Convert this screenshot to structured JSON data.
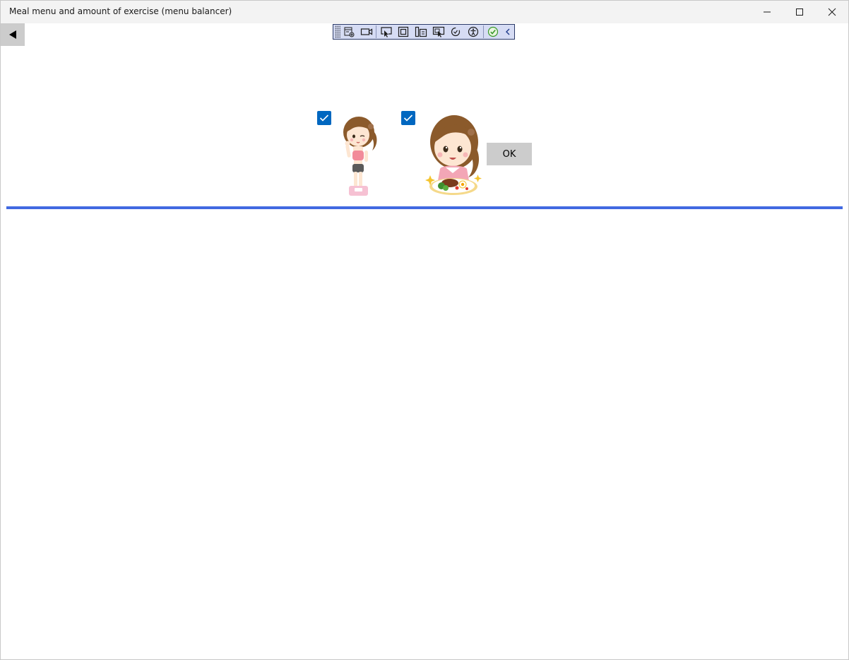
{
  "window": {
    "title": "Meal menu and amount of exercise (menu balancer)",
    "controls": {
      "minimize_icon": "minimize-icon",
      "maximize_icon": "maximize-icon",
      "close_icon": "close-icon"
    }
  },
  "navigation": {
    "back_icon": "back-arrow-icon"
  },
  "debug_toolbar": {
    "items": [
      "live-visual-tree-icon",
      "video-icon",
      "select-element-icon",
      "display-layout-adorners-icon",
      "track-focus-icon",
      "select-adorner-icon",
      "hot-reload-icon",
      "accessibility-icon",
      "check-icon",
      "collapse-icon"
    ]
  },
  "options": [
    {
      "name": "exercise",
      "checked": true,
      "illustration": "woman-on-scale"
    },
    {
      "name": "meal",
      "checked": true,
      "illustration": "woman-with-meal-plate"
    }
  ],
  "actions": {
    "ok_label": "OK"
  },
  "colors": {
    "accent": "#0067c0",
    "divider": "#4169e1",
    "button_bg": "#cccccc",
    "toolbar_bg": "#d6dcf4"
  }
}
